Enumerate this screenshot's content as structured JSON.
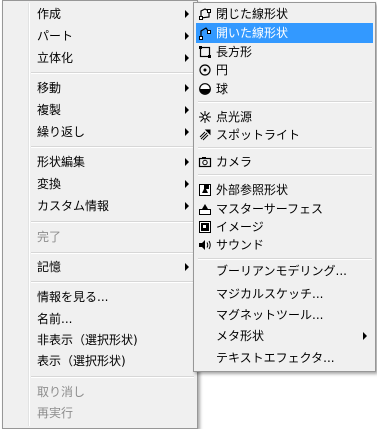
{
  "main_menu": {
    "items": [
      {
        "label": "作成"
      },
      {
        "label": "パート"
      },
      {
        "label": "立体化"
      },
      {
        "label": "移動"
      },
      {
        "label": "複製"
      },
      {
        "label": "繰り返し"
      },
      {
        "label": "形状編集"
      },
      {
        "label": "変換"
      },
      {
        "label": "カスタム情報"
      },
      {
        "label": "完了"
      },
      {
        "label": "記憶"
      },
      {
        "label": "情報を見る..."
      },
      {
        "label": "名前..."
      },
      {
        "label": "非表示（選択形状)"
      },
      {
        "label": "表示（選択形状)"
      },
      {
        "label": "取り消し"
      },
      {
        "label": "再実行"
      }
    ]
  },
  "sub_menu": {
    "items": [
      {
        "label": "閉じた線形状",
        "icon": "closed-line-icon"
      },
      {
        "label": "開いた線形状",
        "icon": "open-line-icon"
      },
      {
        "label": "長方形",
        "icon": "rectangle-icon"
      },
      {
        "label": "円",
        "icon": "circle-icon"
      },
      {
        "label": "球",
        "icon": "sphere-icon"
      },
      {
        "label": "点光源",
        "icon": "point-light-icon"
      },
      {
        "label": "スポットライト",
        "icon": "spotlight-icon"
      },
      {
        "label": "カメラ",
        "icon": "camera-icon"
      },
      {
        "label": "外部参照形状",
        "icon": "external-ref-icon"
      },
      {
        "label": "マスターサーフェス",
        "icon": "master-surface-icon"
      },
      {
        "label": "イメージ",
        "icon": "image-icon"
      },
      {
        "label": "サウンド",
        "icon": "sound-icon"
      },
      {
        "label": "ブーリアンモデリング..."
      },
      {
        "label": "マジカルスケッチ..."
      },
      {
        "label": "マグネットツール..."
      },
      {
        "label": "メタ形状"
      },
      {
        "label": "テキストエフェクタ..."
      }
    ]
  },
  "colors": {
    "highlight": "#3399ff",
    "menu_bg": "#f0f0f0",
    "disabled_text": "#8d8d8d"
  }
}
